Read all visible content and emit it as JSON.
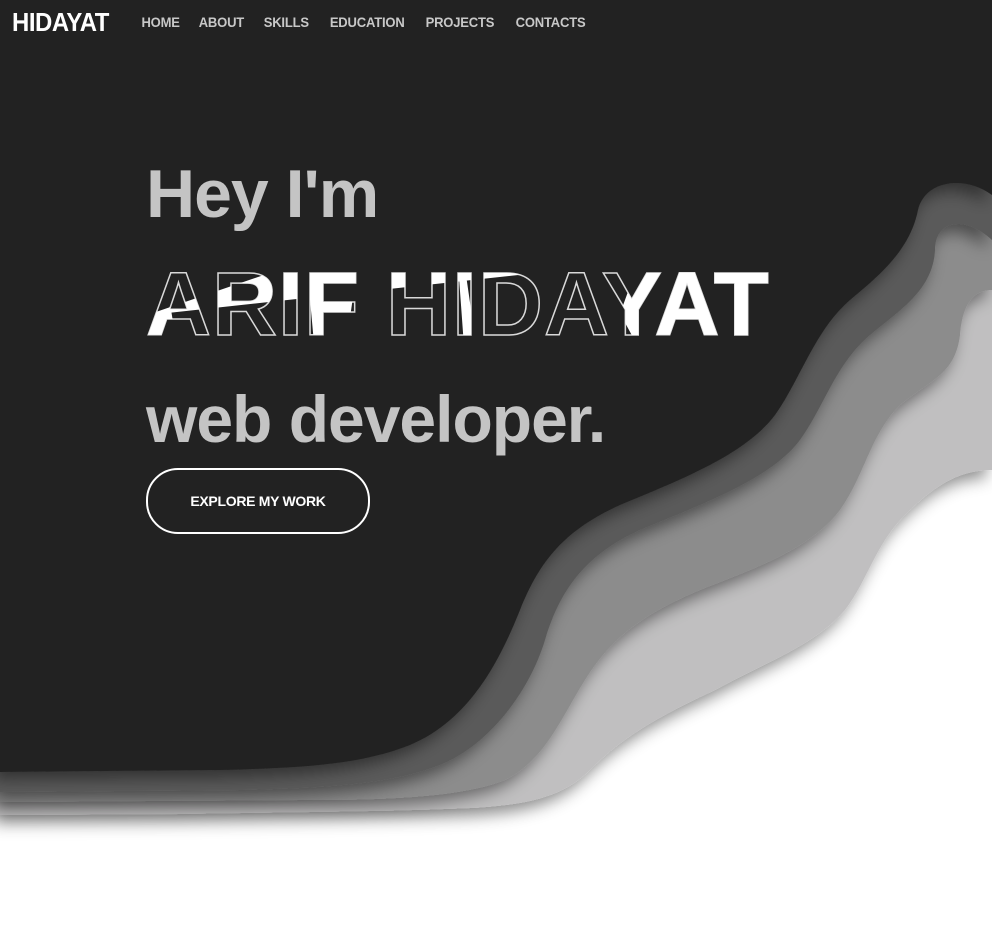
{
  "header": {
    "brand": "HIDAYAT",
    "nav": [
      {
        "label": "HOME"
      },
      {
        "label": "ABOUT"
      },
      {
        "label": "SKILLS"
      },
      {
        "label": "EDUCATION"
      },
      {
        "label": "PROJECTS"
      },
      {
        "label": "CONTACTS"
      }
    ]
  },
  "hero": {
    "greeting": "Hey I'm",
    "name": "ARIF HIDAYAT",
    "role": "web developer.",
    "cta_label": "EXPLORE MY WORK"
  },
  "colors": {
    "background_dark": "#242424",
    "wave_layer_1": "#5a5a5a",
    "wave_layer_2": "#8c8c8c",
    "wave_layer_3": "#c0bfc0",
    "page_bottom": "#ffffff",
    "text_light": "#c4c4c4",
    "text_white": "#ffffff"
  }
}
